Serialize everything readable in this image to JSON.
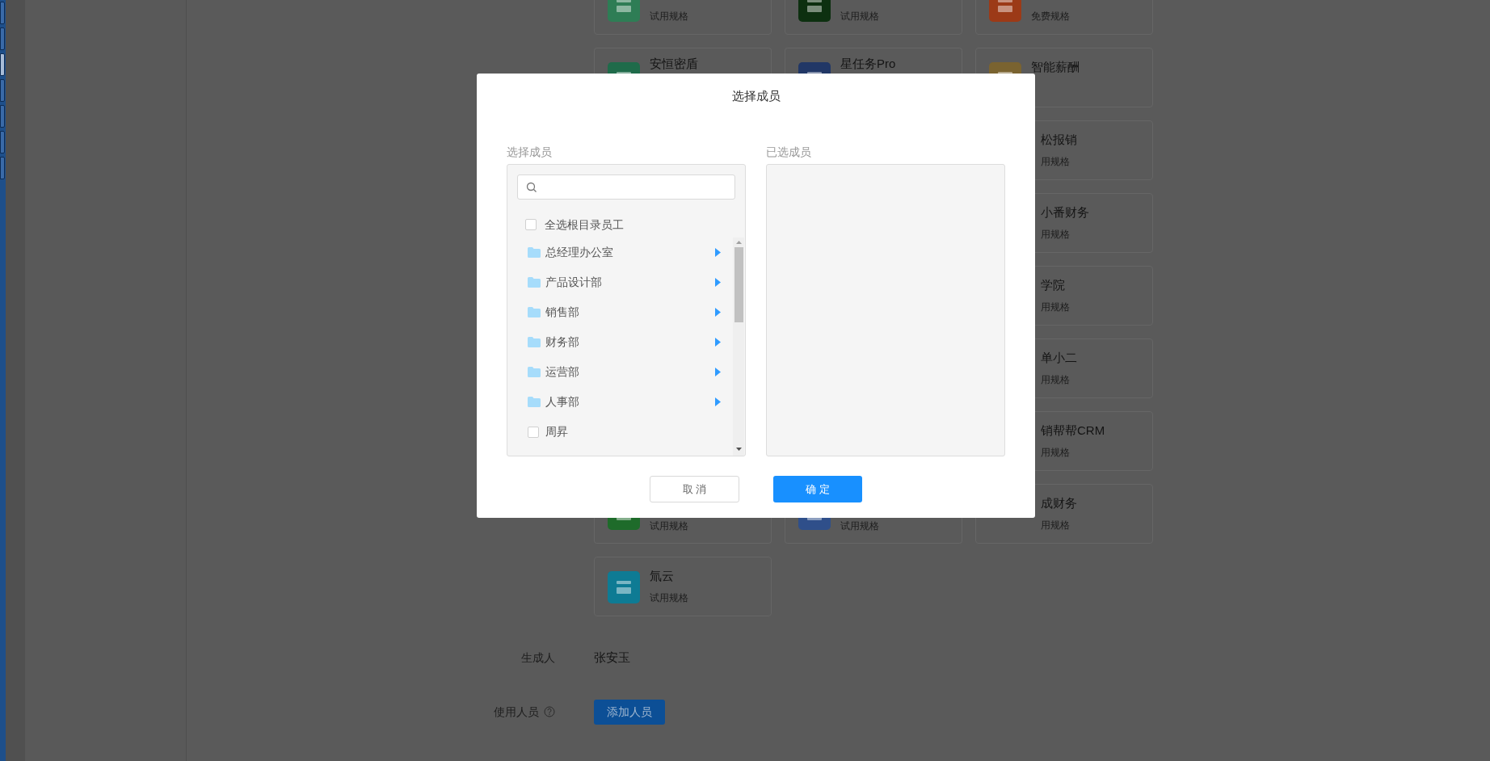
{
  "side_tabs": [
    {
      "selected": false
    },
    {
      "selected": false
    },
    {
      "selected": true
    },
    {
      "selected": false
    },
    {
      "selected": false
    },
    {
      "selected": false
    },
    {
      "selected": false
    }
  ],
  "card_rows": [
    [
      {
        "kind": "full",
        "subtitle": "试用规格",
        "color": "#2e7d55"
      },
      {
        "kind": "full",
        "subtitle": "试用规格",
        "color": "#0d3010"
      },
      {
        "kind": "full",
        "subtitle": "免费规格",
        "color": "#9c3a17"
      }
    ],
    [
      {
        "kind": "upper",
        "title": "安恒密盾",
        "color": "#1f6b4a"
      },
      {
        "kind": "upper",
        "title": "星任务Pro",
        "color": "#213766"
      },
      {
        "kind": "full",
        "title": "智能薪酬",
        "color": "#7a6330"
      }
    ],
    [
      {
        "kind": "hidden"
      },
      {
        "kind": "hidden"
      },
      {
        "kind": "clipped",
        "title": "松报销",
        "subtitle": "用规格"
      }
    ],
    [
      {
        "kind": "hidden"
      },
      {
        "kind": "hidden"
      },
      {
        "kind": "clipped",
        "title": "小番财务",
        "subtitle": "用规格"
      }
    ],
    [
      {
        "kind": "hidden"
      },
      {
        "kind": "hidden"
      },
      {
        "kind": "clipped",
        "title": "学院",
        "subtitle": "用规格"
      }
    ],
    [
      {
        "kind": "hidden"
      },
      {
        "kind": "hidden"
      },
      {
        "kind": "clipped",
        "title": "单小二",
        "subtitle": "用规格"
      }
    ],
    [
      {
        "kind": "hidden"
      },
      {
        "kind": "hidden"
      },
      {
        "kind": "clipped",
        "title": "销帮帮CRM",
        "subtitle": "用规格"
      }
    ],
    [
      {
        "kind": "lower",
        "subtitle": "试用规格",
        "color": "#1e6b2a"
      },
      {
        "kind": "lower",
        "subtitle": "试用规格",
        "color": "#2f4f8a"
      },
      {
        "kind": "clipped",
        "title": "成财务",
        "subtitle": "用规格"
      }
    ],
    [
      {
        "kind": "full",
        "title": "氚云",
        "subtitle": "试用规格",
        "color": "#0e7b94"
      }
    ]
  ],
  "form": {
    "creator_label": "生成人",
    "creator": "张安玉",
    "users_label": "使用人员",
    "add_button": "添加人员"
  },
  "dialog": {
    "title": "选择成员",
    "left_label": "选择成员",
    "right_label": "已选成员",
    "select_all": {
      "label": "全选根目录员工",
      "checked": false
    },
    "items": [
      {
        "kind": "department",
        "label": "总经理办公室"
      },
      {
        "kind": "department",
        "label": "产品设计部"
      },
      {
        "kind": "department",
        "label": "销售部"
      },
      {
        "kind": "department",
        "label": "财务部"
      },
      {
        "kind": "department",
        "label": "运营部"
      },
      {
        "kind": "department",
        "label": "人事部"
      },
      {
        "kind": "member",
        "label": "周昇",
        "checked": false
      }
    ],
    "cancel": "取 消",
    "confirm": "确 定"
  }
}
